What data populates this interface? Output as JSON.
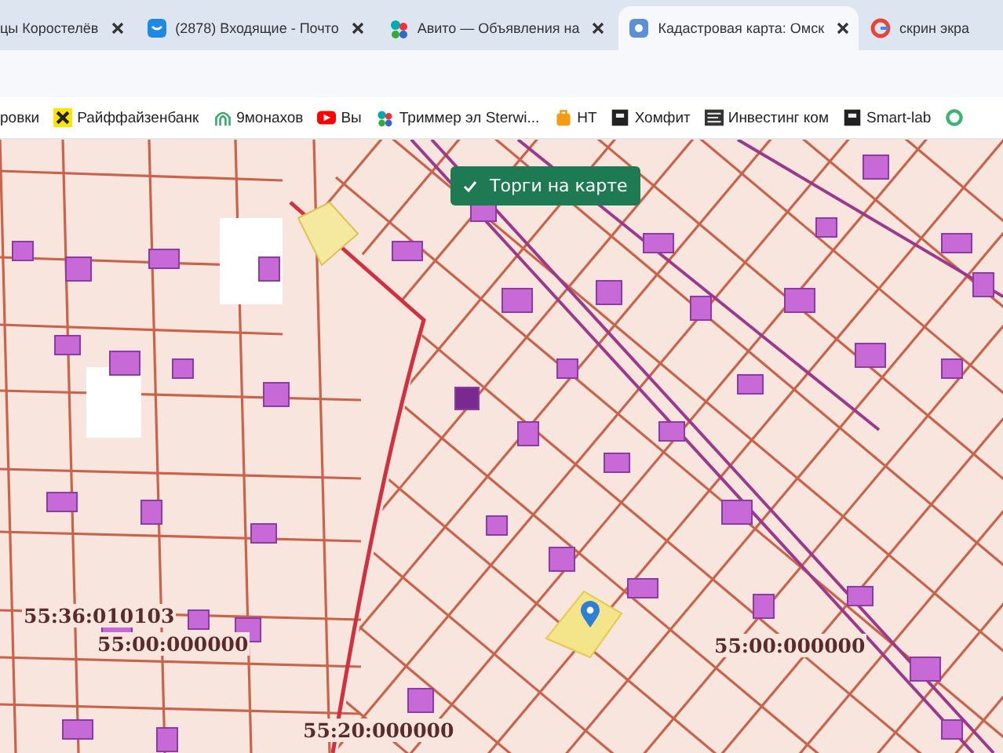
{
  "tabs": [
    {
      "title": "цы Коростелёв",
      "selected": false
    },
    {
      "title": "(2878) Входящие - Почто",
      "selected": false
    },
    {
      "title": "Авито — Объявления на",
      "selected": false
    },
    {
      "title": "Кадастровая карта: Омск",
      "selected": true
    },
    {
      "title": "скрин экра",
      "selected": false
    }
  ],
  "bookmarks": [
    {
      "label": "ровки"
    },
    {
      "label": "Райффайзенбанк"
    },
    {
      "label": "9монахов"
    },
    {
      "label": "Вы"
    },
    {
      "label": "Триммер эл Sterwi..."
    },
    {
      "label": "НТ"
    },
    {
      "label": "Хомфит"
    },
    {
      "label": "Инвестинг ком"
    },
    {
      "label": "Smart-lab"
    }
  ],
  "map": {
    "button": {
      "label": "Торги на карте",
      "checked": true
    },
    "labels": [
      {
        "text": "55:36:010103"
      },
      {
        "text": "55:00:000000"
      },
      {
        "text": "55:00:000000"
      },
      {
        "text": "55:20:000000"
      }
    ]
  }
}
